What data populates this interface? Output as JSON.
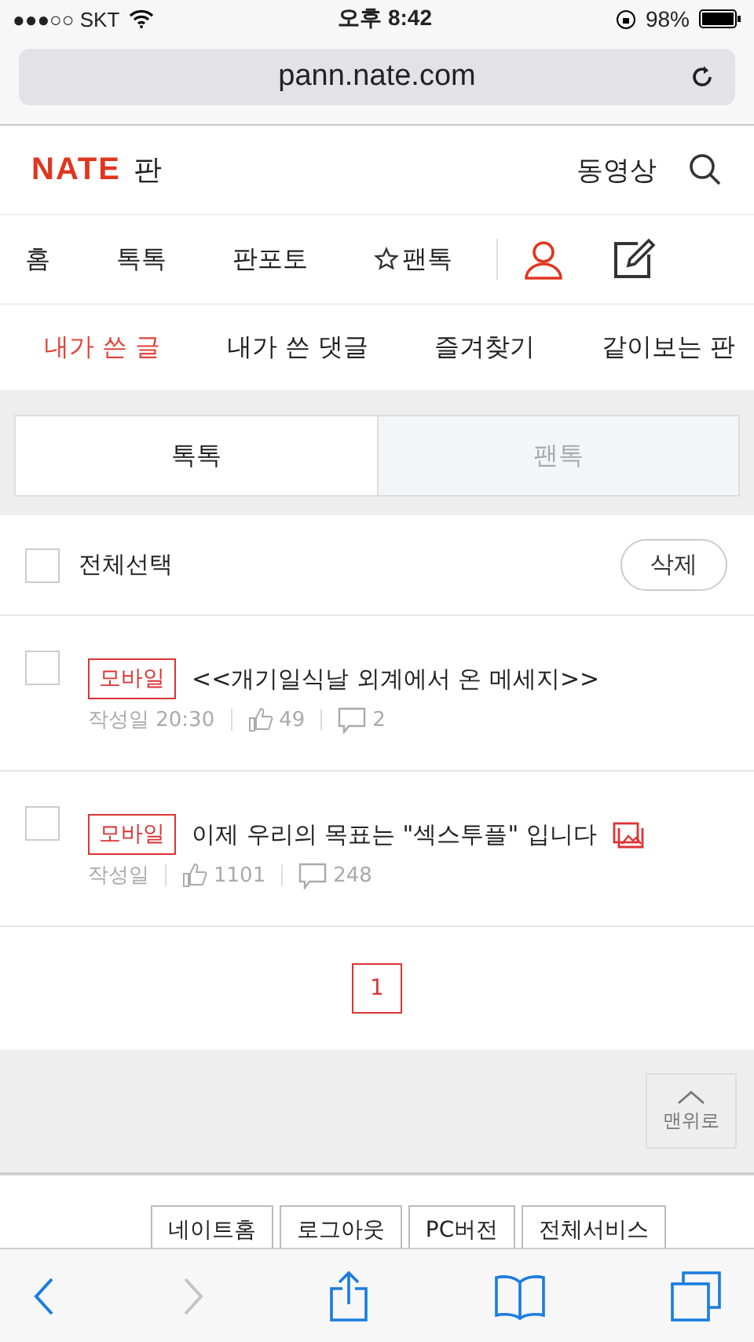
{
  "status_bar": {
    "carrier": "●●●○○ SKT",
    "time": "오후 8:42",
    "battery": "98%"
  },
  "browser": {
    "url": "pann.nate.com"
  },
  "header": {
    "logo": "NATE",
    "title": "판",
    "link": "동영상"
  },
  "nav": [
    {
      "label": "홈",
      "starred": false
    },
    {
      "label": "톡톡",
      "starred": false
    },
    {
      "label": "판포토",
      "starred": false
    },
    {
      "label": "팬톡",
      "starred": true
    }
  ],
  "subtabs": [
    {
      "label": "내가 쓴 글",
      "selected": true
    },
    {
      "label": "내가 쓴 댓글",
      "selected": false
    },
    {
      "label": "즐겨찾기",
      "selected": false
    },
    {
      "label": "같이보는 판",
      "selected": false
    }
  ],
  "segments": [
    {
      "label": "톡톡",
      "selected": true
    },
    {
      "label": "팬톡",
      "selected": false
    }
  ],
  "select_all": {
    "label": "전체선택",
    "checked": false
  },
  "delete_button": "삭제",
  "posts": [
    {
      "category": "모바일",
      "title": "<<개기일식날 외계에서 온 메세지>>",
      "date": "작성일 20:30",
      "likes": "49",
      "comments": "2",
      "has_image": false,
      "checked": false
    },
    {
      "category": "모바일",
      "title": "이제 우리의 목표는 \"섹스투플\" 입니다",
      "date": "작성일",
      "likes": "1101",
      "comments": "248",
      "has_image": true,
      "checked": false
    }
  ],
  "pages": [
    {
      "label": "1",
      "selected": true
    }
  ],
  "top_button": "맨위로",
  "footer_links": [
    "네이트홈",
    "로그아웃",
    "PC버전",
    "전체서비스"
  ]
}
